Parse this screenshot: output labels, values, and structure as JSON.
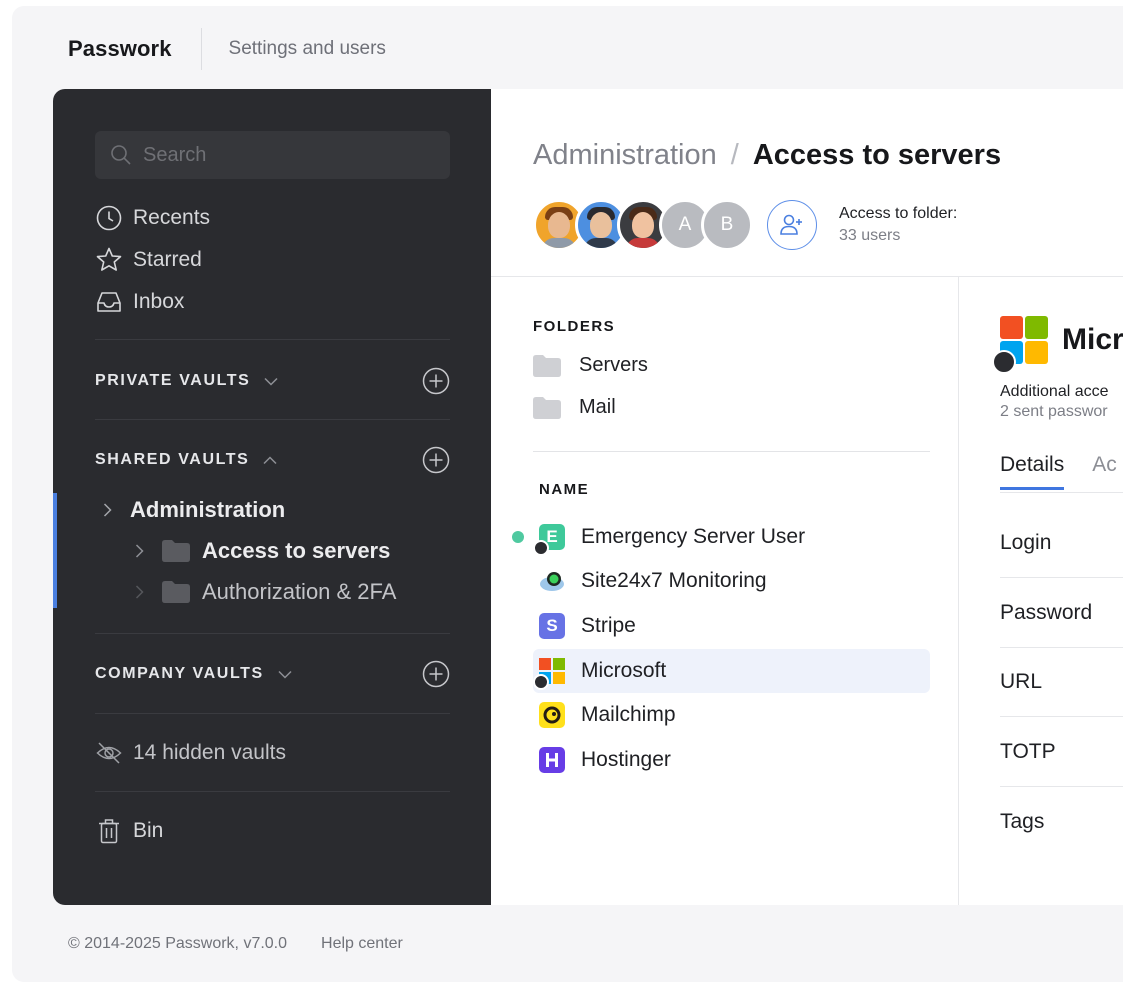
{
  "header": {
    "brand": "Passwork",
    "subtitle": "Settings and users"
  },
  "sidebar": {
    "search_placeholder": "Search",
    "nav": {
      "recents": "Recents",
      "starred": "Starred",
      "inbox": "Inbox"
    },
    "sections": {
      "private": "PRIVATE VAULTS",
      "shared": "SHARED VAULTS",
      "company": "COMPANY VAULTS"
    },
    "tree": {
      "root": "Administration",
      "children": [
        "Access to servers",
        "Authorization & 2FA"
      ]
    },
    "hidden_vaults": "14 hidden vaults",
    "bin": "Bin",
    "accent": "#4a7fe0"
  },
  "footer": {
    "copyright": "© 2014-2025 Passwork, v7.0.0",
    "help": "Help center"
  },
  "main": {
    "breadcrumb": {
      "parent": "Administration",
      "separator": "/",
      "current": "Access to servers"
    },
    "avatars": {
      "letters": [
        "A",
        "B"
      ]
    },
    "access": {
      "title": "Access to folder:",
      "count": "33 users"
    },
    "folders_label": "FOLDERS",
    "folders": [
      "Servers",
      "Mail"
    ],
    "name_label": "NAME",
    "items": [
      "Emergency Server User",
      "Site24x7 Monitoring",
      "Stripe",
      "Microsoft",
      "Mailchimp",
      "Hostinger"
    ],
    "icon_letters": {
      "emergency": "E",
      "stripe": "S"
    },
    "selected_item": "Microsoft"
  },
  "detail": {
    "title": "Micr",
    "additional": "Additional acce",
    "sent": "2 sent passwor",
    "tabs": [
      "Details",
      "Ac"
    ],
    "fields": [
      "Login",
      "Password",
      "URL",
      "TOTP",
      "Tags"
    ]
  }
}
